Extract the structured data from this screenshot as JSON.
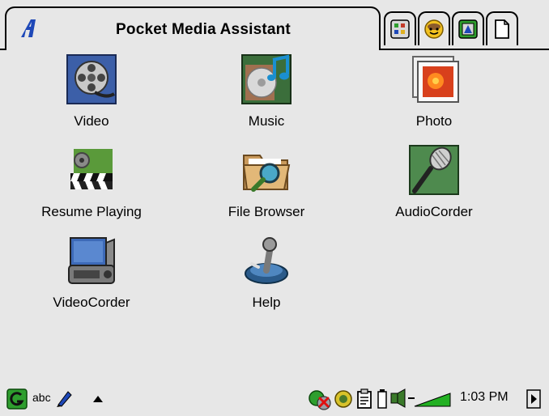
{
  "window": {
    "title": "Pocket Media Assistant"
  },
  "title_tabs": [
    {
      "icon": "apps-grid-icon"
    },
    {
      "icon": "smiley-icon"
    },
    {
      "icon": "media-app-icon"
    },
    {
      "icon": "document-icon"
    }
  ],
  "apps": [
    {
      "label": "Video",
      "icon": "film-reel-icon"
    },
    {
      "label": "Music",
      "icon": "music-cd-icon"
    },
    {
      "label": "Photo",
      "icon": "photo-icon"
    },
    {
      "label": "Resume Playing",
      "icon": "clapperboard-icon"
    },
    {
      "label": "File Browser",
      "icon": "folder-magnifier-icon"
    },
    {
      "label": "AudioCorder",
      "icon": "microphone-icon"
    },
    {
      "label": "VideoCorder",
      "icon": "tv-camera-icon"
    },
    {
      "label": "Help",
      "icon": "help-joystick-icon"
    }
  ],
  "taskbar": {
    "sip_label": "abc",
    "time": "1:03 PM"
  },
  "colors": {
    "background": "#e7e7e7",
    "logo_blue": "#1e48b8",
    "green": "#2e9e2e"
  }
}
